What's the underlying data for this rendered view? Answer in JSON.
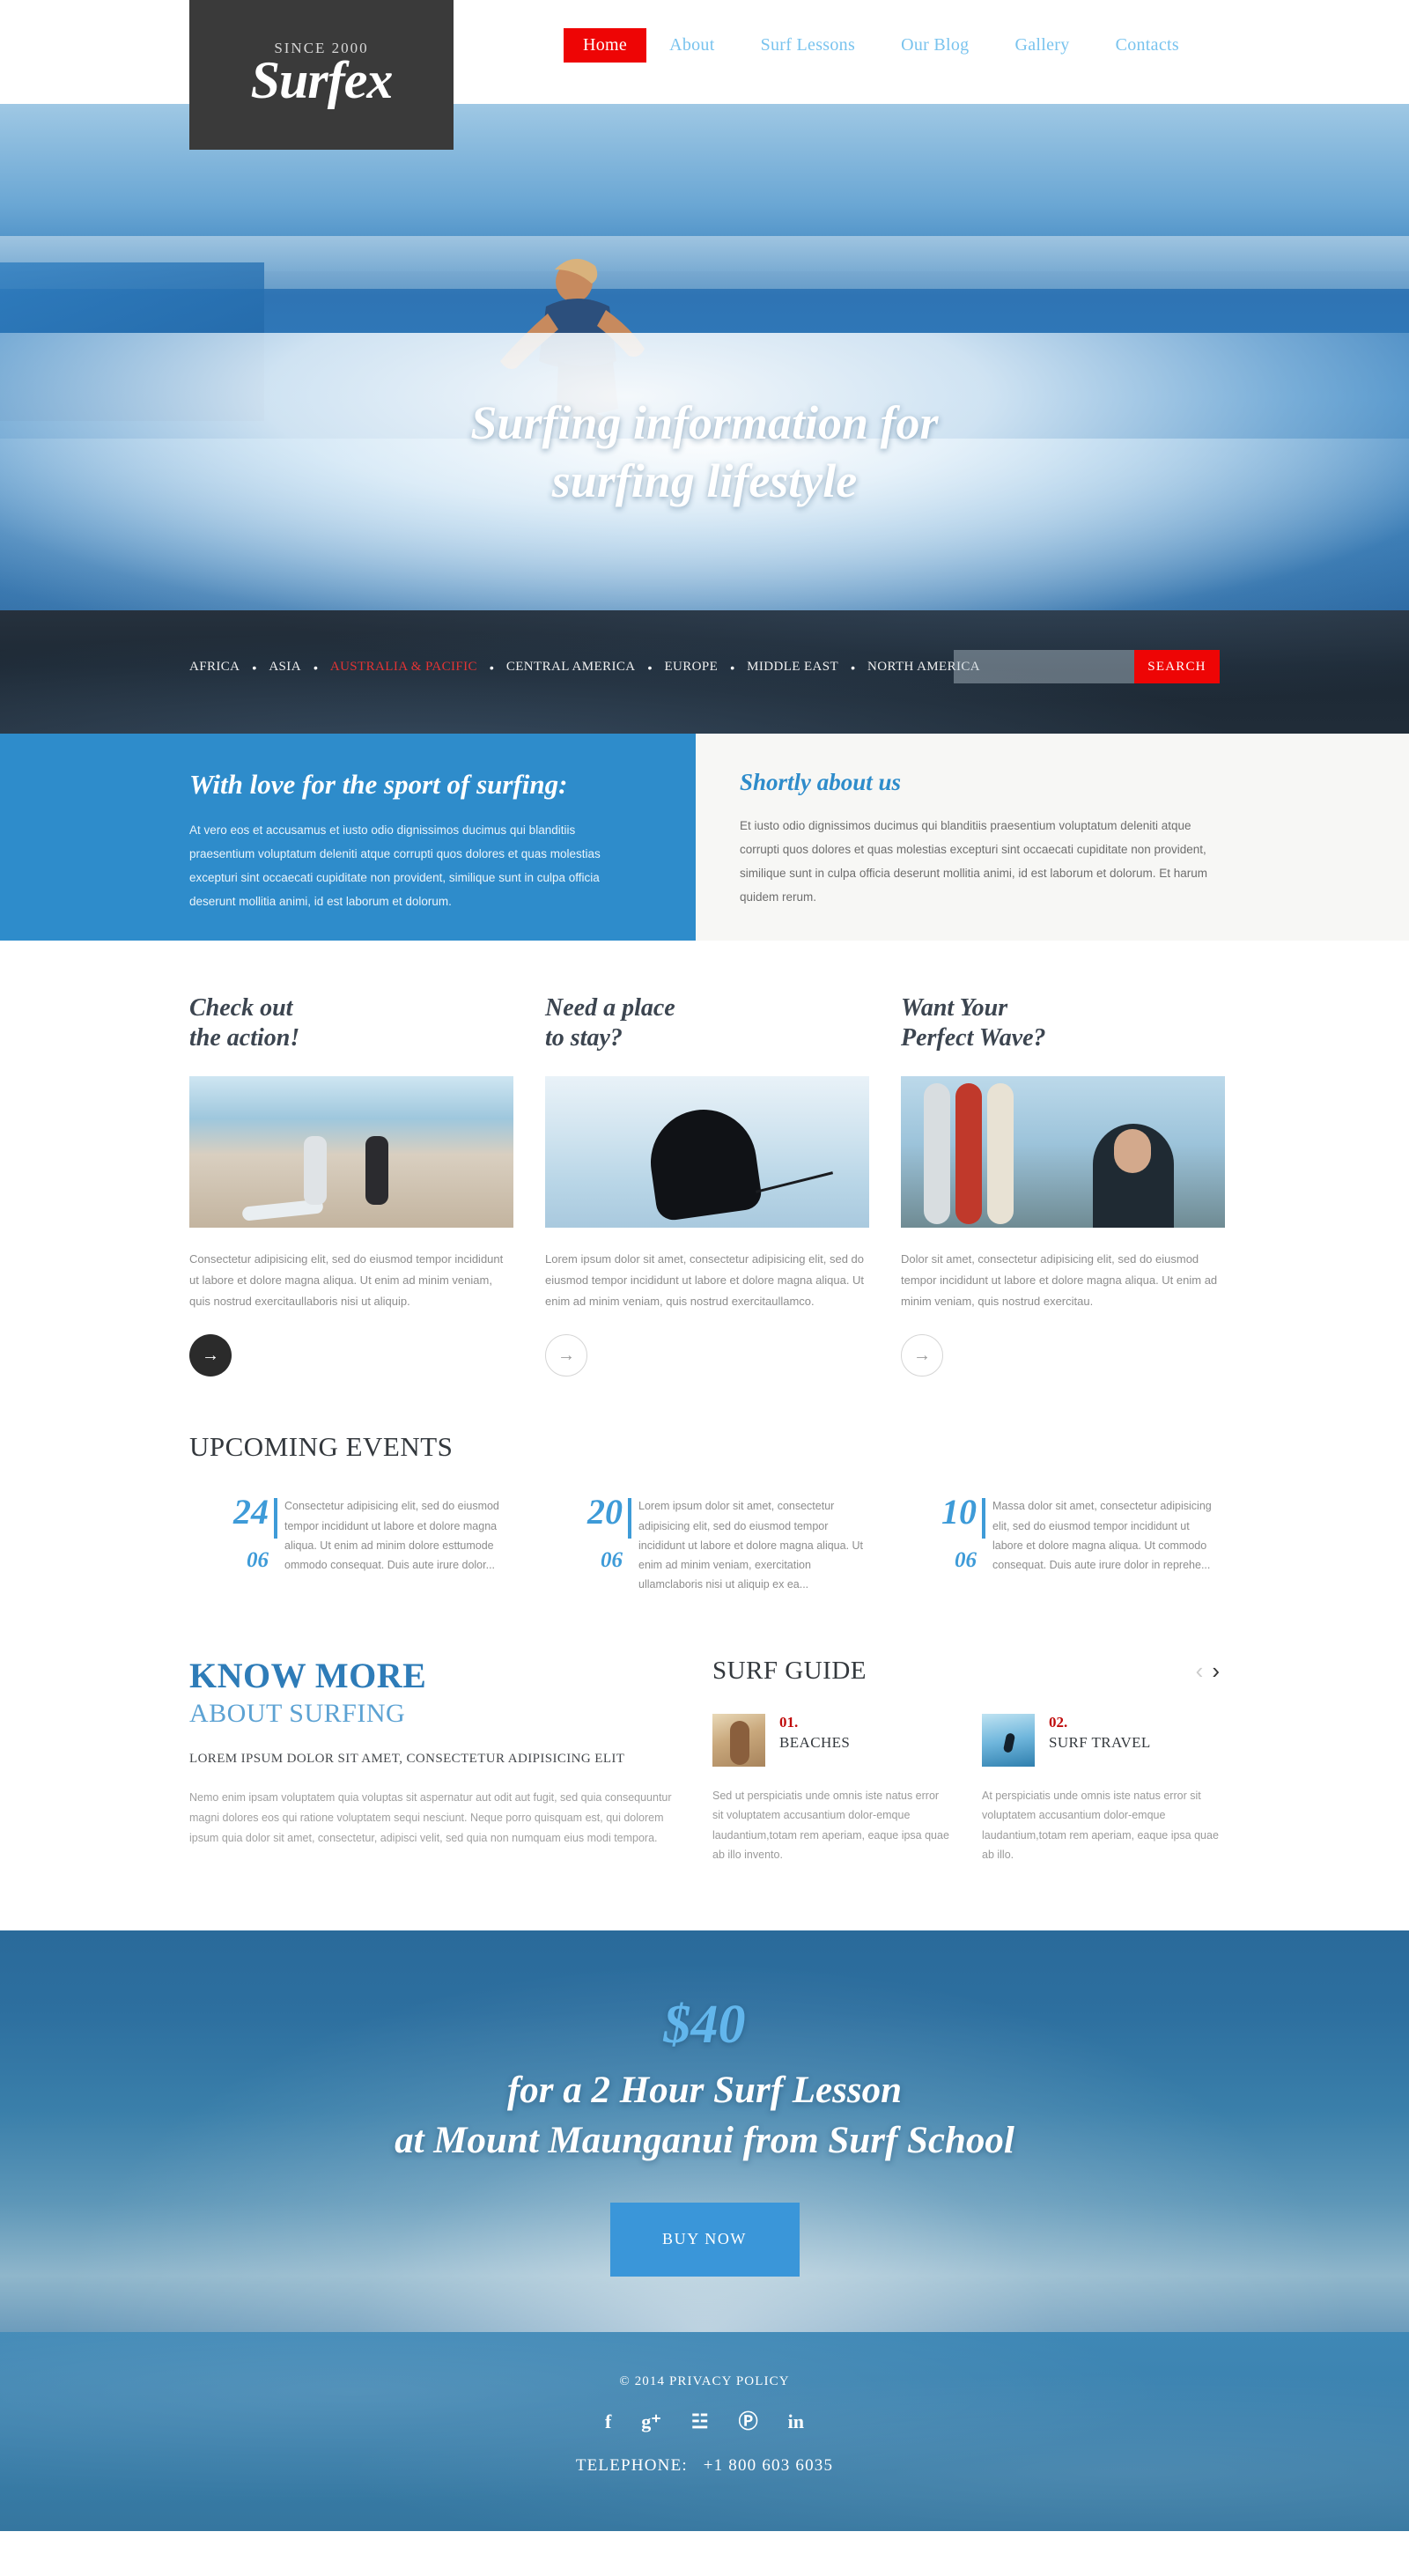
{
  "header": {
    "logo": {
      "since": "SINCE 2000",
      "name": "Surfex"
    },
    "nav": [
      {
        "label": "Home",
        "active": true
      },
      {
        "label": "About",
        "active": false
      },
      {
        "label": "Surf Lessons",
        "active": false
      },
      {
        "label": "Our Blog",
        "active": false
      },
      {
        "label": "Gallery",
        "active": false
      },
      {
        "label": "Contacts",
        "active": false
      }
    ]
  },
  "hero": {
    "title_line1": "Surfing information for",
    "title_line2": "surfing lifestyle",
    "slides": [
      {
        "active": true
      },
      {
        "active": false
      },
      {
        "active": false
      }
    ]
  },
  "regionbar": {
    "regions": [
      {
        "label": "AFRICA",
        "active": false
      },
      {
        "label": "ASIA",
        "active": false
      },
      {
        "label": "AUSTRALIA & PACIFIC",
        "active": true
      },
      {
        "label": "CENTRAL AMERICA",
        "active": false
      },
      {
        "label": "EUROPE",
        "active": false
      },
      {
        "label": "MIDDLE EAST",
        "active": false
      },
      {
        "label": "NORTH AMERICA",
        "active": false
      }
    ],
    "separator": "•",
    "search": {
      "value": "",
      "placeholder": "",
      "button_label": "SEARCH"
    }
  },
  "intro": {
    "left_heading": "With love for the sport of surfing:",
    "left_text": "At vero eos et accusamus et iusto odio dignissimos ducimus qui blanditiis praesentium voluptatum deleniti atque corrupti quos dolores et quas molestias excepturi sint occaecati cupiditate non provident, similique sunt in culpa officia deserunt mollitia animi, id est laborum et dolorum.",
    "right_heading": "Shortly about us",
    "right_text": "Et iusto odio dignissimos ducimus qui blanditiis praesentium voluptatum deleniti atque corrupti quos dolores et quas molestias excepturi sint occaecati cupiditate non provident, similique sunt in culpa officia deserunt mollitia animi, id est laborum et dolorum. Et harum quidem rerum."
  },
  "cards": [
    {
      "heading": "Check out\nthe action!",
      "text": "Consectetur adipisicing elit, sed do eiusmod tempor incididunt ut labore et dolore magna aliqua. Ut enim ad minim veniam, quis nostrud exercitaullaboris nisi ut aliquip.",
      "arrow": "→",
      "arrow_style": "filled"
    },
    {
      "heading": "Need a place\nto stay?",
      "text": "Lorem ipsum dolor sit amet, consectetur adipisicing elit, sed do eiusmod tempor incididunt ut labore et dolore magna aliqua. Ut enim ad minim veniam, quis nostrud exercitaullamco.",
      "arrow": "→",
      "arrow_style": "hollow"
    },
    {
      "heading": "Want Your\nPerfect Wave?",
      "text": "Dolor sit amet, consectetur adipisicing elit, sed do eiusmod tempor incididunt ut labore et dolore magna aliqua. Ut enim ad minim veniam, quis nostrud exercitau.",
      "arrow": "→",
      "arrow_style": "hollow"
    }
  ],
  "events": {
    "heading": "UPCOMING EVENTS",
    "items": [
      {
        "day": "24",
        "month": "06",
        "text": "Consectetur adipisicing elit, sed do eiusmod tempor incididunt ut labore et dolore magna aliqua. Ut enim ad minim dolore esttumode ommodo consequat. Duis aute irure dolor..."
      },
      {
        "day": "20",
        "month": "06",
        "text": "Lorem ipsum dolor sit amet, consectetur adipisicing elit, sed do eiusmod tempor incididunt ut labore et dolore magna aliqua. Ut enim ad minim veniam, exercitation ullamclaboris nisi ut aliquip ex ea..."
      },
      {
        "day": "10",
        "month": "06",
        "text": "Massa dolor sit amet, consectetur adipisicing elit, sed do eiusmod tempor incididunt ut labore et dolore magna aliqua. Ut commodo consequat. Duis aute irure dolor in reprehe..."
      }
    ]
  },
  "know_more": {
    "heading_1": "KNOW MORE",
    "heading_2": "ABOUT SURFING",
    "subheading": "LOREM IPSUM DOLOR SIT AMET, CONSECTETUR ADIPISICING ELIT",
    "text": "Nemo enim ipsam voluptatem quia voluptas sit aspernatur aut odit aut fugit, sed quia consequuntur magni dolores eos qui ratione voluptatem sequi nesciunt. Neque porro quisquam est, qui dolorem ipsum quia dolor sit amet, consectetur, adipisci velit, sed quia non numquam eius modi tempora."
  },
  "surf_guide": {
    "heading": "SURF GUIDE",
    "prev_arrow": "‹",
    "next_arrow": "›",
    "items": [
      {
        "number": "01.",
        "name": "BEACHES",
        "text": "Sed ut perspiciatis unde omnis iste natus error sit voluptatem accusantium dolor-emque laudantium,totam rem aperiam, eaque ipsa quae ab illo invento."
      },
      {
        "number": "02.",
        "name": "SURF TRAVEL",
        "text": "At perspiciatis unde omnis iste natus error sit voluptatem accusantium dolor-emque laudantium,totam rem aperiam, eaque ipsa quae ab illo."
      }
    ]
  },
  "promo": {
    "price": "$40",
    "line1": "for a 2 Hour Surf Lesson",
    "line2": "at Mount Maunganui from Surf School",
    "button_label": "BUY NOW"
  },
  "footer": {
    "copyright": "© 2014 PRIVACY POLICY",
    "socials": [
      {
        "name": "facebook-icon",
        "glyph": "f"
      },
      {
        "name": "google-plus-icon",
        "glyph": "g⁺"
      },
      {
        "name": "rss-icon",
        "glyph": "☳"
      },
      {
        "name": "pinterest-icon",
        "glyph": "Ⓟ"
      },
      {
        "name": "linkedin-icon",
        "glyph": "in"
      }
    ],
    "phone_label": "TELEPHONE:",
    "phone_number": "+1 800 603 6035"
  },
  "colors": {
    "accent_red": "#ee0505",
    "accent_blue": "#2e8ccb",
    "dark": "#3a3a3a",
    "nav_link": "#79c3ee"
  }
}
